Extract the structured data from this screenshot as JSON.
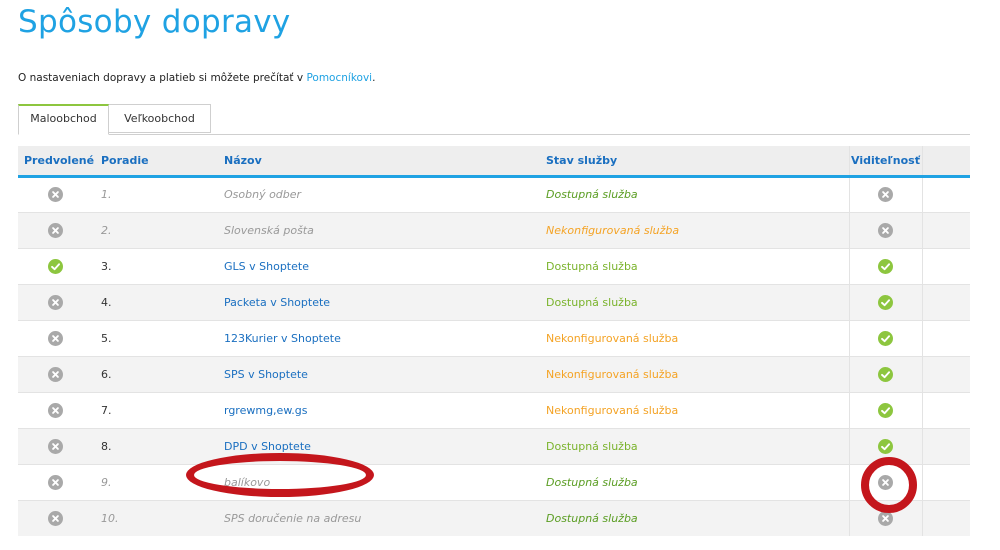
{
  "page": {
    "title": "Spôsoby dopravy",
    "intro_text": "O nastaveniach dopravy a platieb si môžete prečítať v ",
    "intro_link": "Pomocníkovi",
    "intro_end": "."
  },
  "tabs": [
    {
      "label": "Maloobchod",
      "active": true
    },
    {
      "label": "Veľkoobchod",
      "active": false
    }
  ],
  "table": {
    "headers": {
      "default": "Predvolené",
      "order": "Poradie",
      "name": "Názov",
      "status": "Stav služby",
      "visibility": "Viditeľnosť"
    },
    "rows": [
      {
        "default": "no",
        "order": "1.",
        "name": "Osobný odber",
        "status": "Dostupná služba",
        "status_type": "ok",
        "visible": "no",
        "active": false
      },
      {
        "default": "no",
        "order": "2.",
        "name": "Slovenská pošta",
        "status": "Nekonfigurovaná služba",
        "status_type": "warn",
        "visible": "no",
        "active": false
      },
      {
        "default": "yes",
        "order": "3.",
        "name": "GLS v Shoptete",
        "status": "Dostupná služba",
        "status_type": "ok",
        "visible": "yes",
        "active": true
      },
      {
        "default": "no",
        "order": "4.",
        "name": "Packeta v Shoptete",
        "status": "Dostupná služba",
        "status_type": "ok",
        "visible": "yes",
        "active": true
      },
      {
        "default": "no",
        "order": "5.",
        "name": "123Kurier v Shoptete",
        "status": "Nekonfigurovaná služba",
        "status_type": "warn",
        "visible": "yes",
        "active": true
      },
      {
        "default": "no",
        "order": "6.",
        "name": "SPS v Shoptete",
        "status": "Nekonfigurovaná služba",
        "status_type": "warn",
        "visible": "yes",
        "active": true
      },
      {
        "default": "no",
        "order": "7.",
        "name": "rgrewmg,ew.gs",
        "status": "Nekonfigurovaná služba",
        "status_type": "warn",
        "visible": "yes",
        "active": true
      },
      {
        "default": "no",
        "order": "8.",
        "name": "DPD v Shoptete",
        "status": "Dostupná služba",
        "status_type": "ok",
        "visible": "yes",
        "active": true
      },
      {
        "default": "no",
        "order": "9.",
        "name": "balíkovo",
        "status": "Dostupná služba",
        "status_type": "ok",
        "visible": "no",
        "active": false
      },
      {
        "default": "no",
        "order": "10.",
        "name": "SPS doručenie na adresu",
        "status": "Dostupná služba",
        "status_type": "ok",
        "visible": "no",
        "active": false
      }
    ]
  },
  "colors": {
    "accent": "#1fa2e3",
    "link": "#1a6fc0",
    "ok": "#7ab32b",
    "warn": "#f4a325",
    "check": "#8dc63f",
    "cross": "#a9a9a9",
    "annotation": "#c4161c"
  },
  "icons": {
    "yes": "check-circle-icon",
    "no": "x-circle-icon"
  }
}
